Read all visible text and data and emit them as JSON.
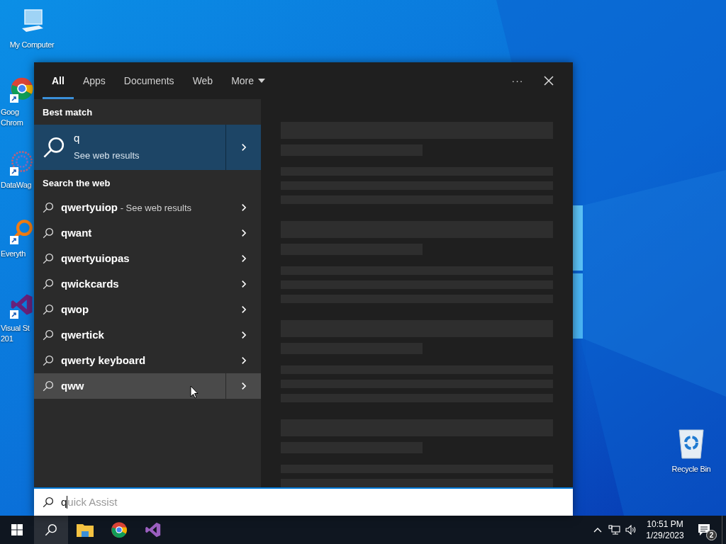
{
  "desktop_icons": [
    {
      "kind": "computer",
      "lines": [
        "My Computer"
      ]
    },
    {
      "kind": "chrome",
      "lines": [
        "Goog",
        "Chrom"
      ]
    },
    {
      "kind": "datawag",
      "lines": [
        "DataWag"
      ]
    },
    {
      "kind": "everything",
      "lines": [
        "Everyth"
      ]
    },
    {
      "kind": "visualstudio",
      "lines": [
        "Visual St",
        "201"
      ]
    },
    {
      "kind": "recycle",
      "lines": [
        "Recycle Bin"
      ]
    }
  ],
  "search_panel": {
    "tabs": [
      {
        "label": "All",
        "selected": true
      },
      {
        "label": "Apps",
        "selected": false
      },
      {
        "label": "Documents",
        "selected": false
      },
      {
        "label": "Web",
        "selected": false
      },
      {
        "label": "More",
        "selected": false,
        "dropdown": true
      }
    ],
    "more_options": "···",
    "best_match": {
      "heading": "Best match",
      "title": "q",
      "subtitle": "See web results",
      "selected": true
    },
    "web_heading": "Search the web",
    "web_results": [
      {
        "query": "qwertyuiop",
        "suffix": "- See web results",
        "selected": false
      },
      {
        "query": "qwant",
        "selected": false
      },
      {
        "query": "qwertyuiopas",
        "selected": false
      },
      {
        "query": "qwickcards",
        "selected": false
      },
      {
        "query": "qwop",
        "selected": false
      },
      {
        "query": "qwertick",
        "selected": false
      },
      {
        "query": "qwerty keyboard",
        "selected": false
      },
      {
        "query": "qww",
        "selected": true
      }
    ],
    "search_box": {
      "value": "q",
      "suggestion": "uick Assist"
    }
  },
  "taskbar": {
    "apps": [
      {
        "kind": "search",
        "active": true
      },
      {
        "kind": "explorer",
        "active": false
      },
      {
        "kind": "chrome",
        "active": false
      },
      {
        "kind": "visualstudio",
        "active": false
      }
    ],
    "time": "10:51 PM",
    "date": "1/29/2023",
    "notification_count": "2"
  }
}
